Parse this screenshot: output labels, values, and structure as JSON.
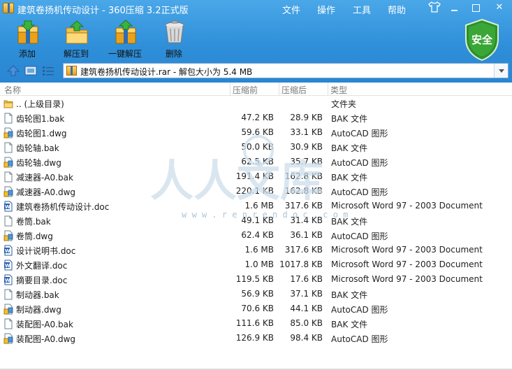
{
  "window": {
    "title": "建筑卷扬机传动设计 - 360压缩 3.2正式版",
    "menus": [
      "文件",
      "操作",
      "工具",
      "帮助"
    ],
    "buttons": {
      "minimize_icon": "minimize-icon",
      "maximize_icon": "maximize-icon",
      "close_symbol": "✕"
    }
  },
  "toolbar": {
    "add": "添加",
    "extract_to": "解压到",
    "one_click_extract": "一键解压",
    "delete": "删除"
  },
  "security_badge": {
    "label": "安全",
    "color": "#2e8f2b"
  },
  "address_bar": {
    "path": "建筑卷扬机传动设计.rar - 解包大小为 5.4 MB"
  },
  "columns": {
    "name": "名称",
    "original": "压缩前",
    "compressed": "压缩后",
    "type": "类型"
  },
  "files": [
    {
      "name": ".. (上级目录)",
      "original": "",
      "compressed": "",
      "type": "文件夹",
      "icon": "folder-icon"
    },
    {
      "name": "齿轮图1.bak",
      "original": "47.2 KB",
      "compressed": "28.9 KB",
      "type": "BAK 文件",
      "icon": "file-icon"
    },
    {
      "name": "齿轮图1.dwg",
      "original": "59.6 KB",
      "compressed": "33.1 KB",
      "type": "AutoCAD 图形",
      "icon": "dwg-icon"
    },
    {
      "name": "齿轮轴.bak",
      "original": "50.0 KB",
      "compressed": "30.9 KB",
      "type": "BAK 文件",
      "icon": "file-icon"
    },
    {
      "name": "齿轮轴.dwg",
      "original": "62.5 KB",
      "compressed": "35.7 KB",
      "type": "AutoCAD 图形",
      "icon": "dwg-icon"
    },
    {
      "name": "减速器-A0.bak",
      "original": "191.4 KB",
      "compressed": "162.8 KB",
      "type": "BAK 文件",
      "icon": "file-icon"
    },
    {
      "name": "减速器-A0.dwg",
      "original": "220.1 KB",
      "compressed": "162.8 KB",
      "type": "AutoCAD 图形",
      "icon": "dwg-icon"
    },
    {
      "name": "建筑卷扬机传动设计.doc",
      "original": "1.6 MB",
      "compressed": "317.6 KB",
      "type": "Microsoft Word 97 - 2003 Document",
      "icon": "word-icon"
    },
    {
      "name": "卷筒.bak",
      "original": "49.1 KB",
      "compressed": "31.4 KB",
      "type": "BAK 文件",
      "icon": "file-icon"
    },
    {
      "name": "卷筒.dwg",
      "original": "62.4 KB",
      "compressed": "36.1 KB",
      "type": "AutoCAD 图形",
      "icon": "dwg-icon"
    },
    {
      "name": "设计说明书.doc",
      "original": "1.6 MB",
      "compressed": "317.6 KB",
      "type": "Microsoft Word 97 - 2003 Document",
      "icon": "word-icon"
    },
    {
      "name": "外文翻译.doc",
      "original": "1.0 MB",
      "compressed": "1017.8 KB",
      "type": "Microsoft Word 97 - 2003 Document",
      "icon": "word-icon"
    },
    {
      "name": "摘要目录.doc",
      "original": "119.5 KB",
      "compressed": "17.6 KB",
      "type": "Microsoft Word 97 - 2003 Document",
      "icon": "word-icon"
    },
    {
      "name": "制动器.bak",
      "original": "56.9 KB",
      "compressed": "37.1 KB",
      "type": "BAK 文件",
      "icon": "file-icon"
    },
    {
      "name": "制动器.dwg",
      "original": "70.6 KB",
      "compressed": "44.1 KB",
      "type": "AutoCAD 图形",
      "icon": "dwg-icon"
    },
    {
      "name": "装配图-A0.bak",
      "original": "111.6 KB",
      "compressed": "85.0 KB",
      "type": "BAK 文件",
      "icon": "file-icon"
    },
    {
      "name": "装配图-A0.dwg",
      "original": "126.9 KB",
      "compressed": "98.4 KB",
      "type": "AutoCAD 图形",
      "icon": "dwg-icon"
    }
  ],
  "watermark": {
    "text": "人人文库",
    "sub": "w w w . r e n r e n d o c . c o m"
  }
}
